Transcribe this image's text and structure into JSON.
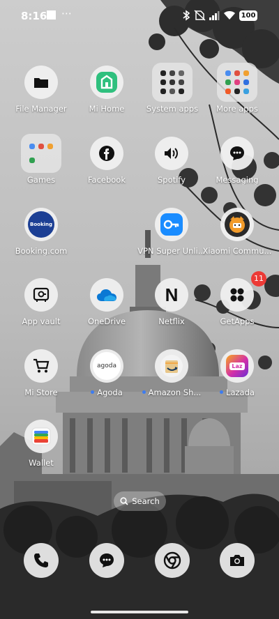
{
  "status_bar": {
    "time": "8:16",
    "battery": "100",
    "icons": [
      "bluetooth-icon",
      "no-sim-icon",
      "signal-icon",
      "wifi-icon",
      "battery-icon"
    ]
  },
  "apps": [
    {
      "label": "File Manager",
      "icon": "folder-icon"
    },
    {
      "label": "Mi Home",
      "icon": "mi-home-icon"
    },
    {
      "label": "System apps",
      "icon": "folder-grid-icon"
    },
    {
      "label": "More apps",
      "icon": "folder-grid-icon"
    },
    {
      "label": "Games",
      "icon": "folder-grid-icon"
    },
    {
      "label": "Facebook",
      "icon": "facebook-icon"
    },
    {
      "label": "Spotify",
      "icon": "speaker-icon"
    },
    {
      "label": "Messaging",
      "icon": "chat-bubble-icon"
    },
    {
      "label": "Booking.com",
      "icon": "booking-icon",
      "icon_text": "Booking"
    },
    {
      "label": "VPN Super Unli...",
      "icon": "vpn-key-icon"
    },
    {
      "label": "Xiaomi Commu...",
      "icon": "xiaomi-community-icon"
    },
    {
      "label": "App vault",
      "icon": "vault-icon"
    },
    {
      "label": "OneDrive",
      "icon": "cloud-icon"
    },
    {
      "label": "Netflix",
      "icon": "netflix-icon",
      "icon_text": "N"
    },
    {
      "label": "GetApps",
      "icon": "getapps-icon",
      "badge": "11"
    },
    {
      "label": "Mi Store",
      "icon": "cart-icon"
    },
    {
      "label": "Agoda",
      "icon": "agoda-icon",
      "icon_text": "agoda",
      "new": true
    },
    {
      "label": "Amazon Sh...",
      "icon": "amazon-icon",
      "new": true
    },
    {
      "label": "Lazada",
      "icon": "lazada-icon",
      "icon_text": "Laz",
      "new": true
    },
    {
      "label": "Wallet",
      "icon": "wallet-icon"
    }
  ],
  "search": {
    "label": "Search"
  },
  "dock": [
    {
      "name": "phone-icon"
    },
    {
      "name": "messages-icon"
    },
    {
      "name": "chrome-icon"
    },
    {
      "name": "camera-icon"
    }
  ],
  "colors": {
    "badge": "#ec3a36",
    "new_dot": "#3d7cf0",
    "mi_home": "#2fc07e",
    "booking": "#1c3f94",
    "onedrive": "#0a78d4",
    "lazada": "#d32fa8",
    "amazon": "#f3a847"
  }
}
